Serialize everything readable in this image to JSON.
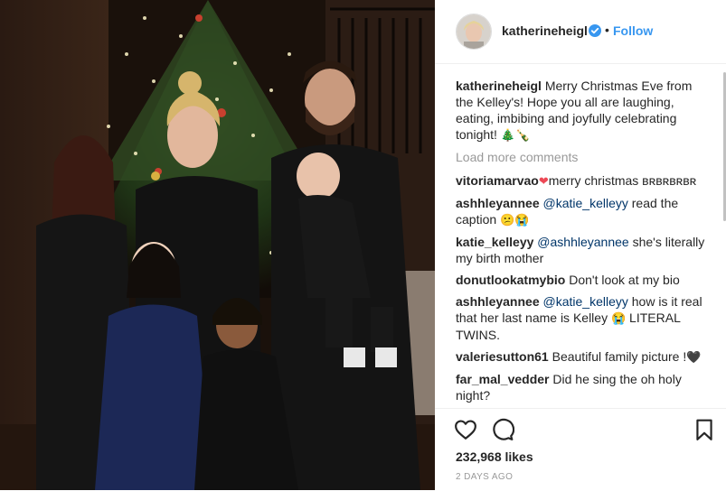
{
  "post": {
    "username": "katherineheigl",
    "follow_label": "Follow",
    "separator": "•",
    "caption": {
      "username": "katherineheigl",
      "text": "Merry Christmas Eve from the Kelley's! Hope you all are laughing, eating, imbibing and joyfully celebrating tonight!",
      "emoji": "🎄🍾"
    },
    "load_more_label": "Load more comments",
    "comments": [
      {
        "user": "vitoriamarvao",
        "emoji": "❤",
        "text": "merry christmas ʙʀʙʀʙʀʙʀ"
      },
      {
        "user": "ashhleyannee",
        "mention": "@katie_kelleyy",
        "text": " read the caption ",
        "emoji": "😕😭"
      },
      {
        "user": "katie_kelleyy",
        "mention": "@ashhleyannee",
        "text": " she's literally my birth mother"
      },
      {
        "user": "donutlookatmybio",
        "text": "Don't look at my bio"
      },
      {
        "user": "ashhleyannee",
        "mention": "@katie_kelleyy",
        "text": " how is it real that her last name is Kelley ",
        "emoji": "😭",
        "text2": " LITERAL TWINS."
      },
      {
        "user": "valeriesutton61",
        "text": "Beautiful family picture !",
        "emoji": "🖤"
      },
      {
        "user": "far_mal_vedder",
        "text": "Did he sing the oh holy night?"
      }
    ],
    "likes": "232,968 likes",
    "time_ago": "2 DAYS AGO",
    "icons": {
      "like": "heart-icon",
      "comment": "comment-icon",
      "save": "bookmark-icon",
      "verified": "verified-badge-icon"
    },
    "colors": {
      "accent": "#3897f0",
      "mention": "#003569",
      "muted": "#999999",
      "text": "#262626"
    }
  }
}
